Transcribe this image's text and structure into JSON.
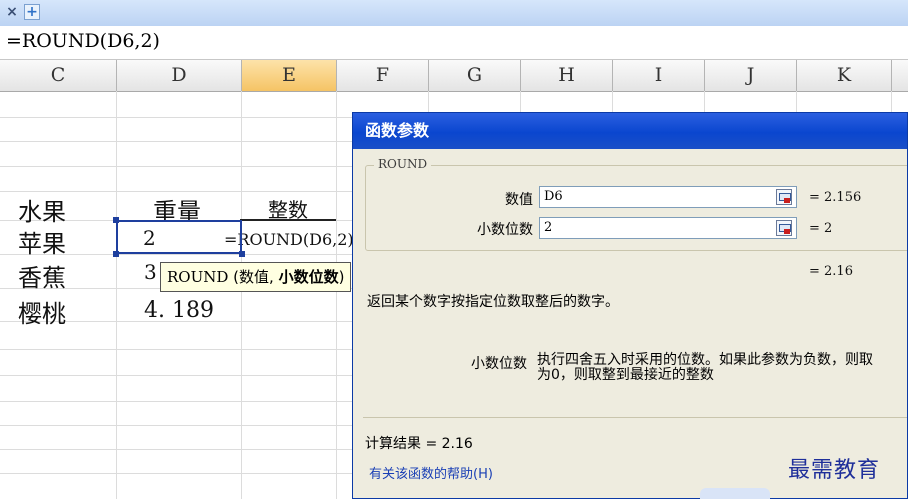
{
  "tabs": {
    "close_glyph": "×",
    "add_glyph": "+"
  },
  "formula_bar": {
    "text": "=ROUND(D6,2)"
  },
  "columns": [
    "C",
    "D",
    "E",
    "F",
    "G",
    "H",
    "I",
    "J",
    "K"
  ],
  "active_column": "E",
  "cells": {
    "header": {
      "fruit": "水果",
      "weight": "重量",
      "integer": "整数"
    },
    "rows": [
      {
        "name": "苹果",
        "weight": "2",
        "formula": "=ROUND(D6,2)"
      },
      {
        "name": "香蕉",
        "weight": "3"
      },
      {
        "name": "樱桃",
        "weight": "4. 189"
      }
    ]
  },
  "tooltip": {
    "func": "ROUND",
    "open": "(数值,",
    "bold_arg": "小数位数",
    "close": ")"
  },
  "dialog": {
    "title": "函数参数",
    "group_label": "ROUND",
    "args": [
      {
        "label": "数值",
        "value": "D6",
        "result": "= 2.156"
      },
      {
        "label": "小数位数",
        "value": "2",
        "result": "= 2"
      }
    ],
    "formula_result_preview": "= 2.16",
    "description": "返回某个数字按指定位数取整后的数字。",
    "param_name": "小数位数",
    "param_desc_line1": "执行四舍五入时采用的位数。如果此参数为负数，则取",
    "param_desc_line2": "为0，则取整到最接近的整数",
    "calc_result": "计算结果 = 2.16",
    "help_link": "有关该函数的帮助(H)"
  },
  "watermark": "最需教育",
  "colors": {
    "selection": "#1e3f9e",
    "dialog_title": "#0a46cf",
    "active_header": "#f5c465",
    "link": "#1a3fb5"
  }
}
